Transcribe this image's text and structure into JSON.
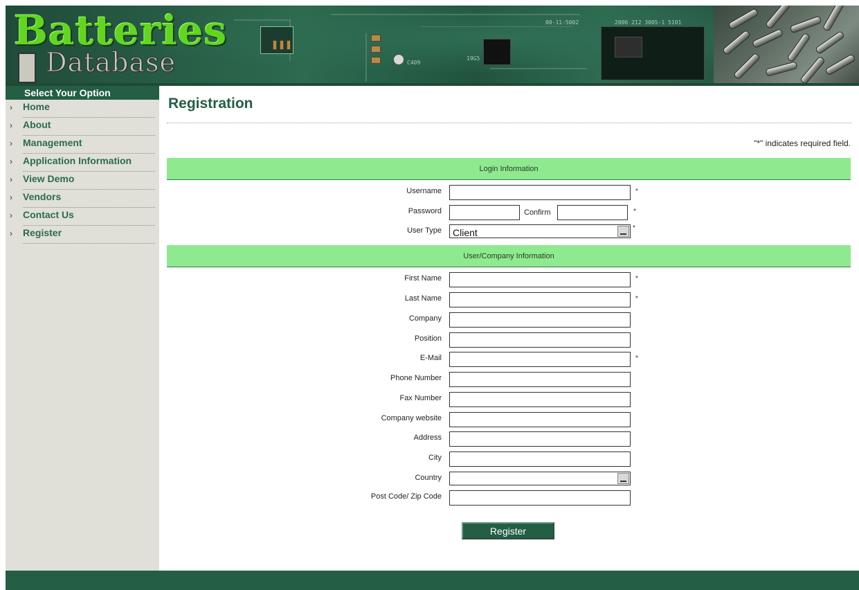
{
  "header": {
    "logo_main": "Batteries",
    "logo_sub": "Database"
  },
  "sidebar": {
    "title": "Select Your Option",
    "items": [
      {
        "label": "Home"
      },
      {
        "label": "About"
      },
      {
        "label": "Management"
      },
      {
        "label": "Application Information"
      },
      {
        "label": "View Demo"
      },
      {
        "label": "Vendors"
      },
      {
        "label": "Contact Us"
      },
      {
        "label": "Register"
      }
    ]
  },
  "main": {
    "title": "Registration",
    "required_note": "\"*\" indicates required field.",
    "login_section": {
      "title": "Login Information",
      "username_label": "Username",
      "password_label": "Password",
      "confirm_label": "Confirm",
      "user_type_label": "User Type",
      "user_type_value": "Client",
      "required_mark": "*"
    },
    "company_section": {
      "title": "User/Company Information",
      "fields": {
        "first_name": "First Name",
        "last_name": "Last Name",
        "company": "Company",
        "position": "Position",
        "email": "E-Mail",
        "phone": "Phone Number",
        "fax": "Fax Number",
        "website": "Company website",
        "address": "Address",
        "city": "City",
        "country": "Country",
        "postcode": "Post Code/ Zip Code"
      }
    },
    "register_button": "Register"
  },
  "colors": {
    "brand_green": "#235e45",
    "section_green": "#8fea8f",
    "sidebar_bg": "#e0e0d8",
    "link_green": "#2c6b4d"
  }
}
